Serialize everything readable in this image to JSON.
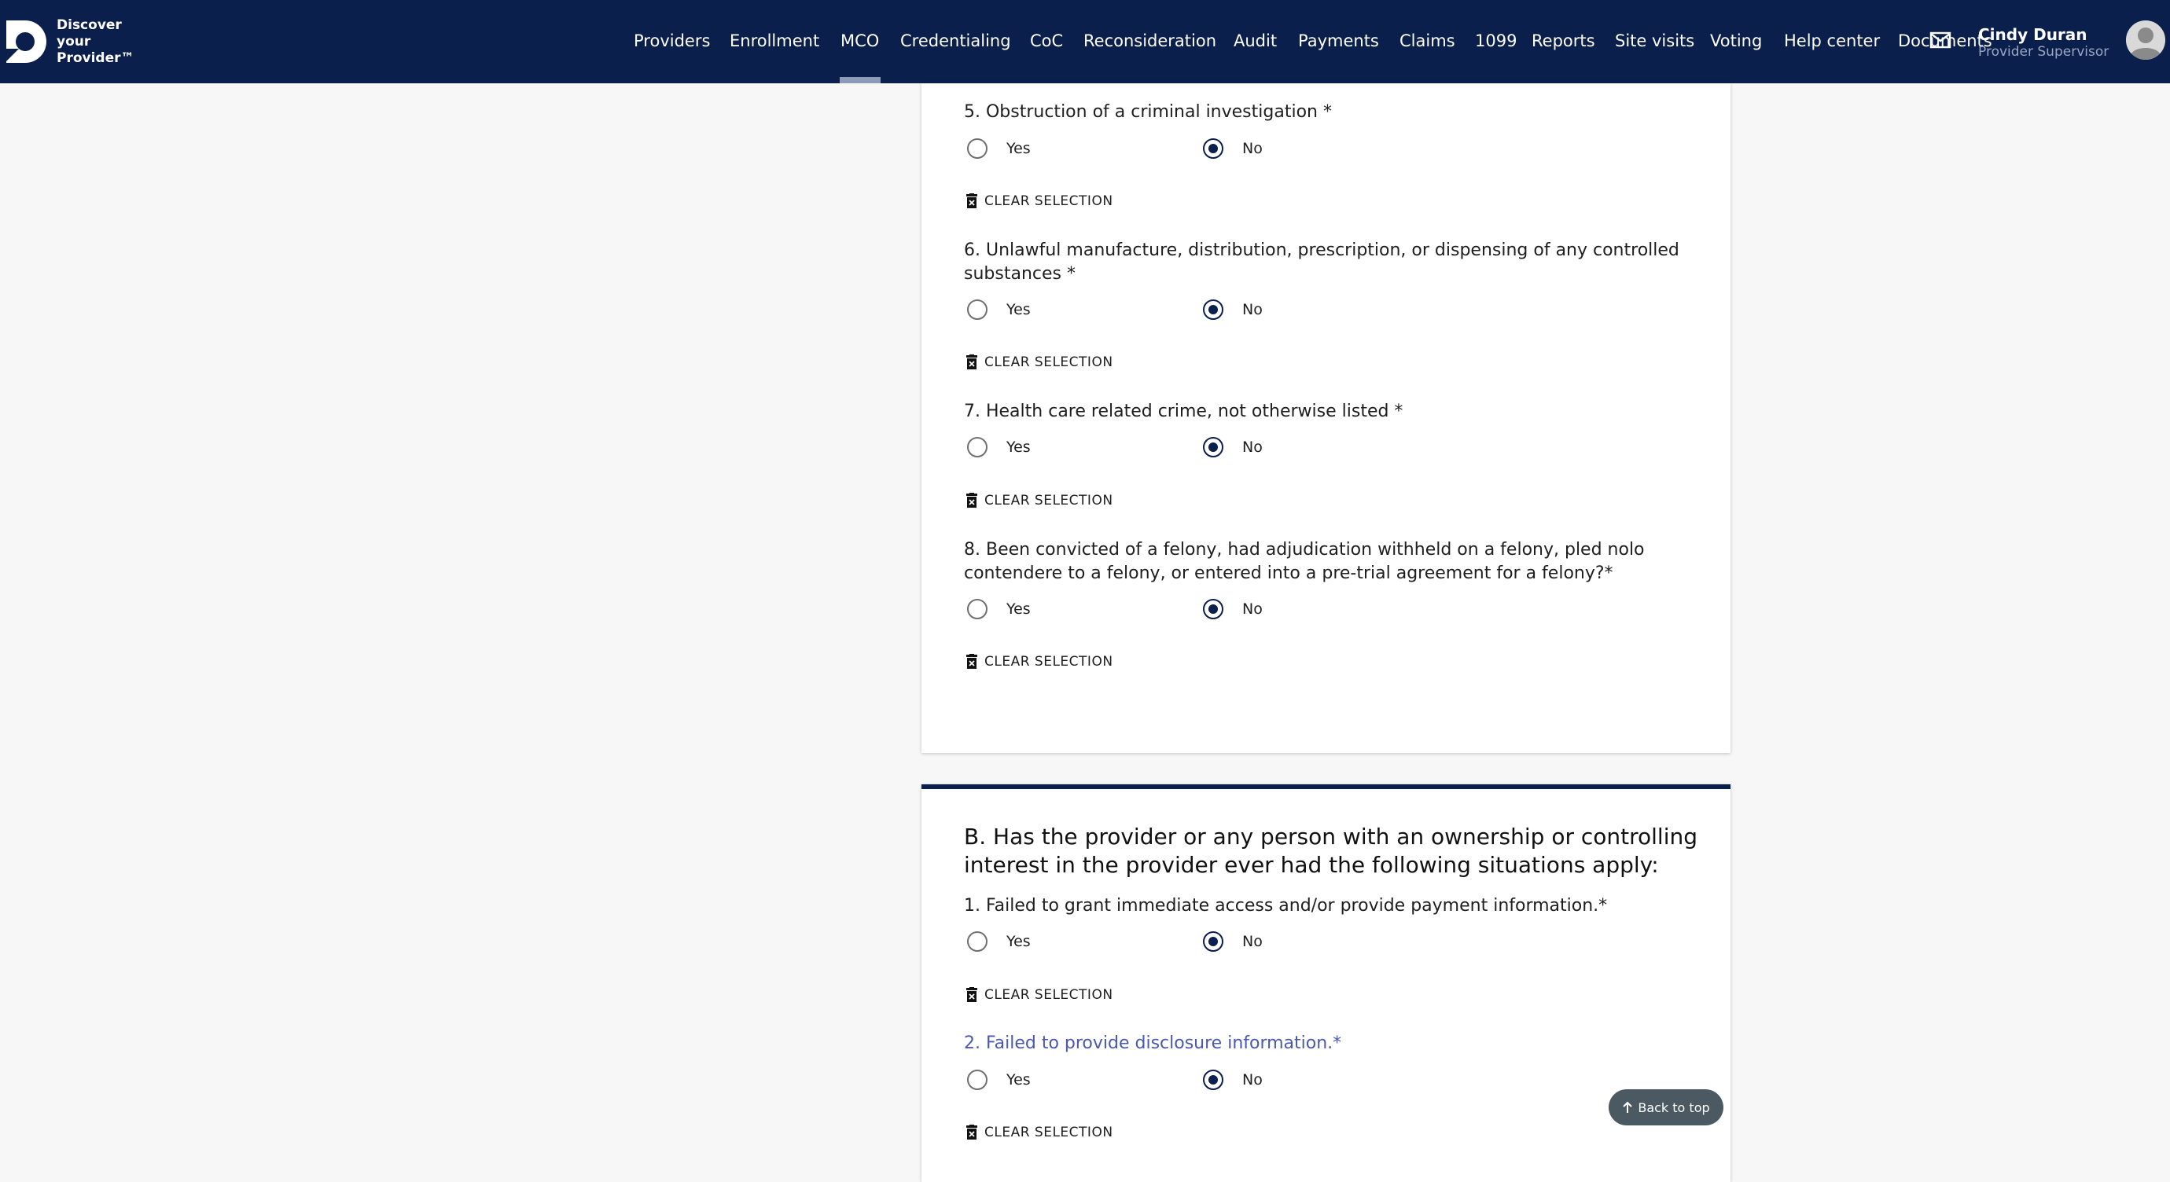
{
  "brand": {
    "line1": "Discover",
    "line2": "your",
    "line3": "Provider™"
  },
  "nav": {
    "items": [
      "Providers",
      "Enrollment",
      "MCO",
      "Credentialing",
      "CoC",
      "Reconsideration",
      "Audit",
      "Payments",
      "Claims",
      "1099",
      "Reports",
      "Site visits",
      "Voting",
      "Help center",
      "Documents"
    ],
    "active": "MCO"
  },
  "user": {
    "name": "Cindy Duran",
    "role": "Provider Supervisor"
  },
  "options": {
    "yes": "Yes",
    "no": "No"
  },
  "clear_label": "CLEAR SELECTION",
  "required_marker": "*",
  "section_a": {
    "questions": [
      {
        "text": "5. Obstruction of a criminal investigation  *",
        "selected": "No"
      },
      {
        "text": "6. Unlawful manufacture, distribution, prescription, or dispensing of any controlled substances  *",
        "selected": "No"
      },
      {
        "text": "7. Health care related crime, not otherwise listed  *",
        "selected": "No"
      },
      {
        "text": "8. Been convicted of a felony, had adjudication withheld on a felony, pled nolo contendere to a felony, or entered into a pre-trial agreement for a felony?*",
        "selected": "No"
      }
    ]
  },
  "section_b": {
    "title": "B. Has the provider or any person with an ownership or controlling interest in the provider ever had the following situations apply:",
    "questions": [
      {
        "text": "1. Failed to grant immediate access and/or provide payment information.*",
        "selected": "No"
      },
      {
        "text": "2. Failed to provide disclosure information.*",
        "selected": "No"
      }
    ]
  },
  "back_to_top": "Back to top",
  "colors": {
    "navy": "#0b1f4d",
    "highlight": "#4a58b0",
    "button_gray": "#4b5a62"
  }
}
